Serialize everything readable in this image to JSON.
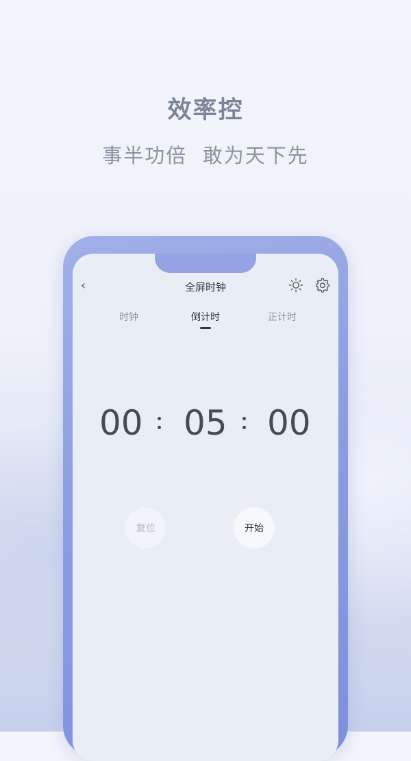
{
  "promo": {
    "headline": "效率控",
    "subline": "事半功倍  敢为天下先"
  },
  "app": {
    "nav": {
      "back_glyph": "‹",
      "title": "全屏时钟",
      "brightness_icon": "brightness-icon",
      "settings_icon": "gear-icon"
    },
    "tabs": [
      {
        "label": "时钟",
        "active": false
      },
      {
        "label": "倒计时",
        "active": true
      },
      {
        "label": "正计时",
        "active": false
      }
    ],
    "countdown": {
      "hours": "00",
      "minutes": "05",
      "seconds": "00"
    },
    "buttons": {
      "reset_label": "复位",
      "start_label": "开始"
    }
  },
  "colors": {
    "frame": "#8f9ee2",
    "screen": "#e9edf5",
    "text_primary": "#2f3440",
    "text_muted": "#8e939e"
  }
}
